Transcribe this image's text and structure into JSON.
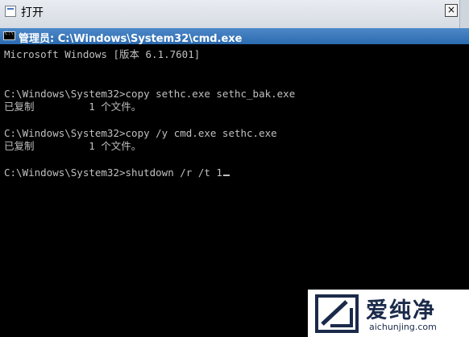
{
  "background_dialog": {
    "title": "打开",
    "close_label": "×"
  },
  "cmd_window": {
    "title": "管理员: C:\\Windows\\System32\\cmd.exe"
  },
  "console": {
    "lines": [
      "Microsoft Windows [版本 6.1.7601]",
      "C:\\Windows\\System32>copy sethc.exe sethc_bak.exe",
      "已复制         1 个文件。",
      "C:\\Windows\\System32>copy /y cmd.exe sethc.exe",
      "已复制         1 个文件。",
      "C:\\Windows\\System32>shutdown /r /t 1"
    ]
  },
  "watermark": {
    "brand": "爱纯净",
    "url": "aichunjing.com"
  },
  "colors": {
    "console_bg": "#000000",
    "console_text": "#c0c0c0",
    "titlebar": "#2c6bb0"
  }
}
